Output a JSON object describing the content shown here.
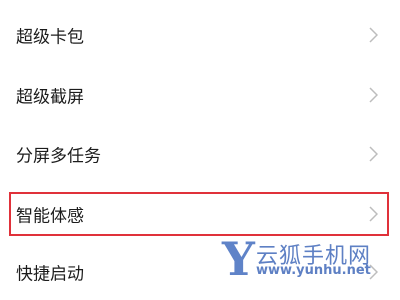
{
  "settings_list": {
    "items": [
      {
        "label": "超级卡包"
      },
      {
        "label": "超级截屏"
      },
      {
        "label": "分屏多任务"
      },
      {
        "label": "智能体感"
      },
      {
        "label": "快捷启动"
      }
    ],
    "highlighted_item": "智能体感",
    "chevron_icon": "chevron-right-icon"
  },
  "watermark": {
    "logo_letter": "Y",
    "site_name": "云狐手机网",
    "url": "www.yunhu.net"
  },
  "colors": {
    "highlight_border": "#e0313a",
    "chevron": "#bdbdbd",
    "watermark": "#5e80c4"
  }
}
